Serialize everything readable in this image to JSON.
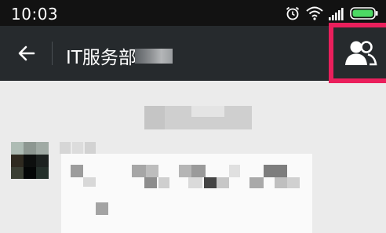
{
  "status_bar": {
    "time": "10:03",
    "icons": [
      "alarm-icon",
      "wifi-icon",
      "signal-icon",
      "battery-icon"
    ]
  },
  "header": {
    "back_icon": "arrow-left-icon",
    "title": "IT服务部",
    "members_icon": "group-members-icon",
    "highlight_color": "#ea1f5c"
  },
  "colors": {
    "status_bar": "#121212",
    "title_bar": "#262a2d",
    "chat_background": "#ebebeb",
    "bubble": "#fafafa"
  }
}
